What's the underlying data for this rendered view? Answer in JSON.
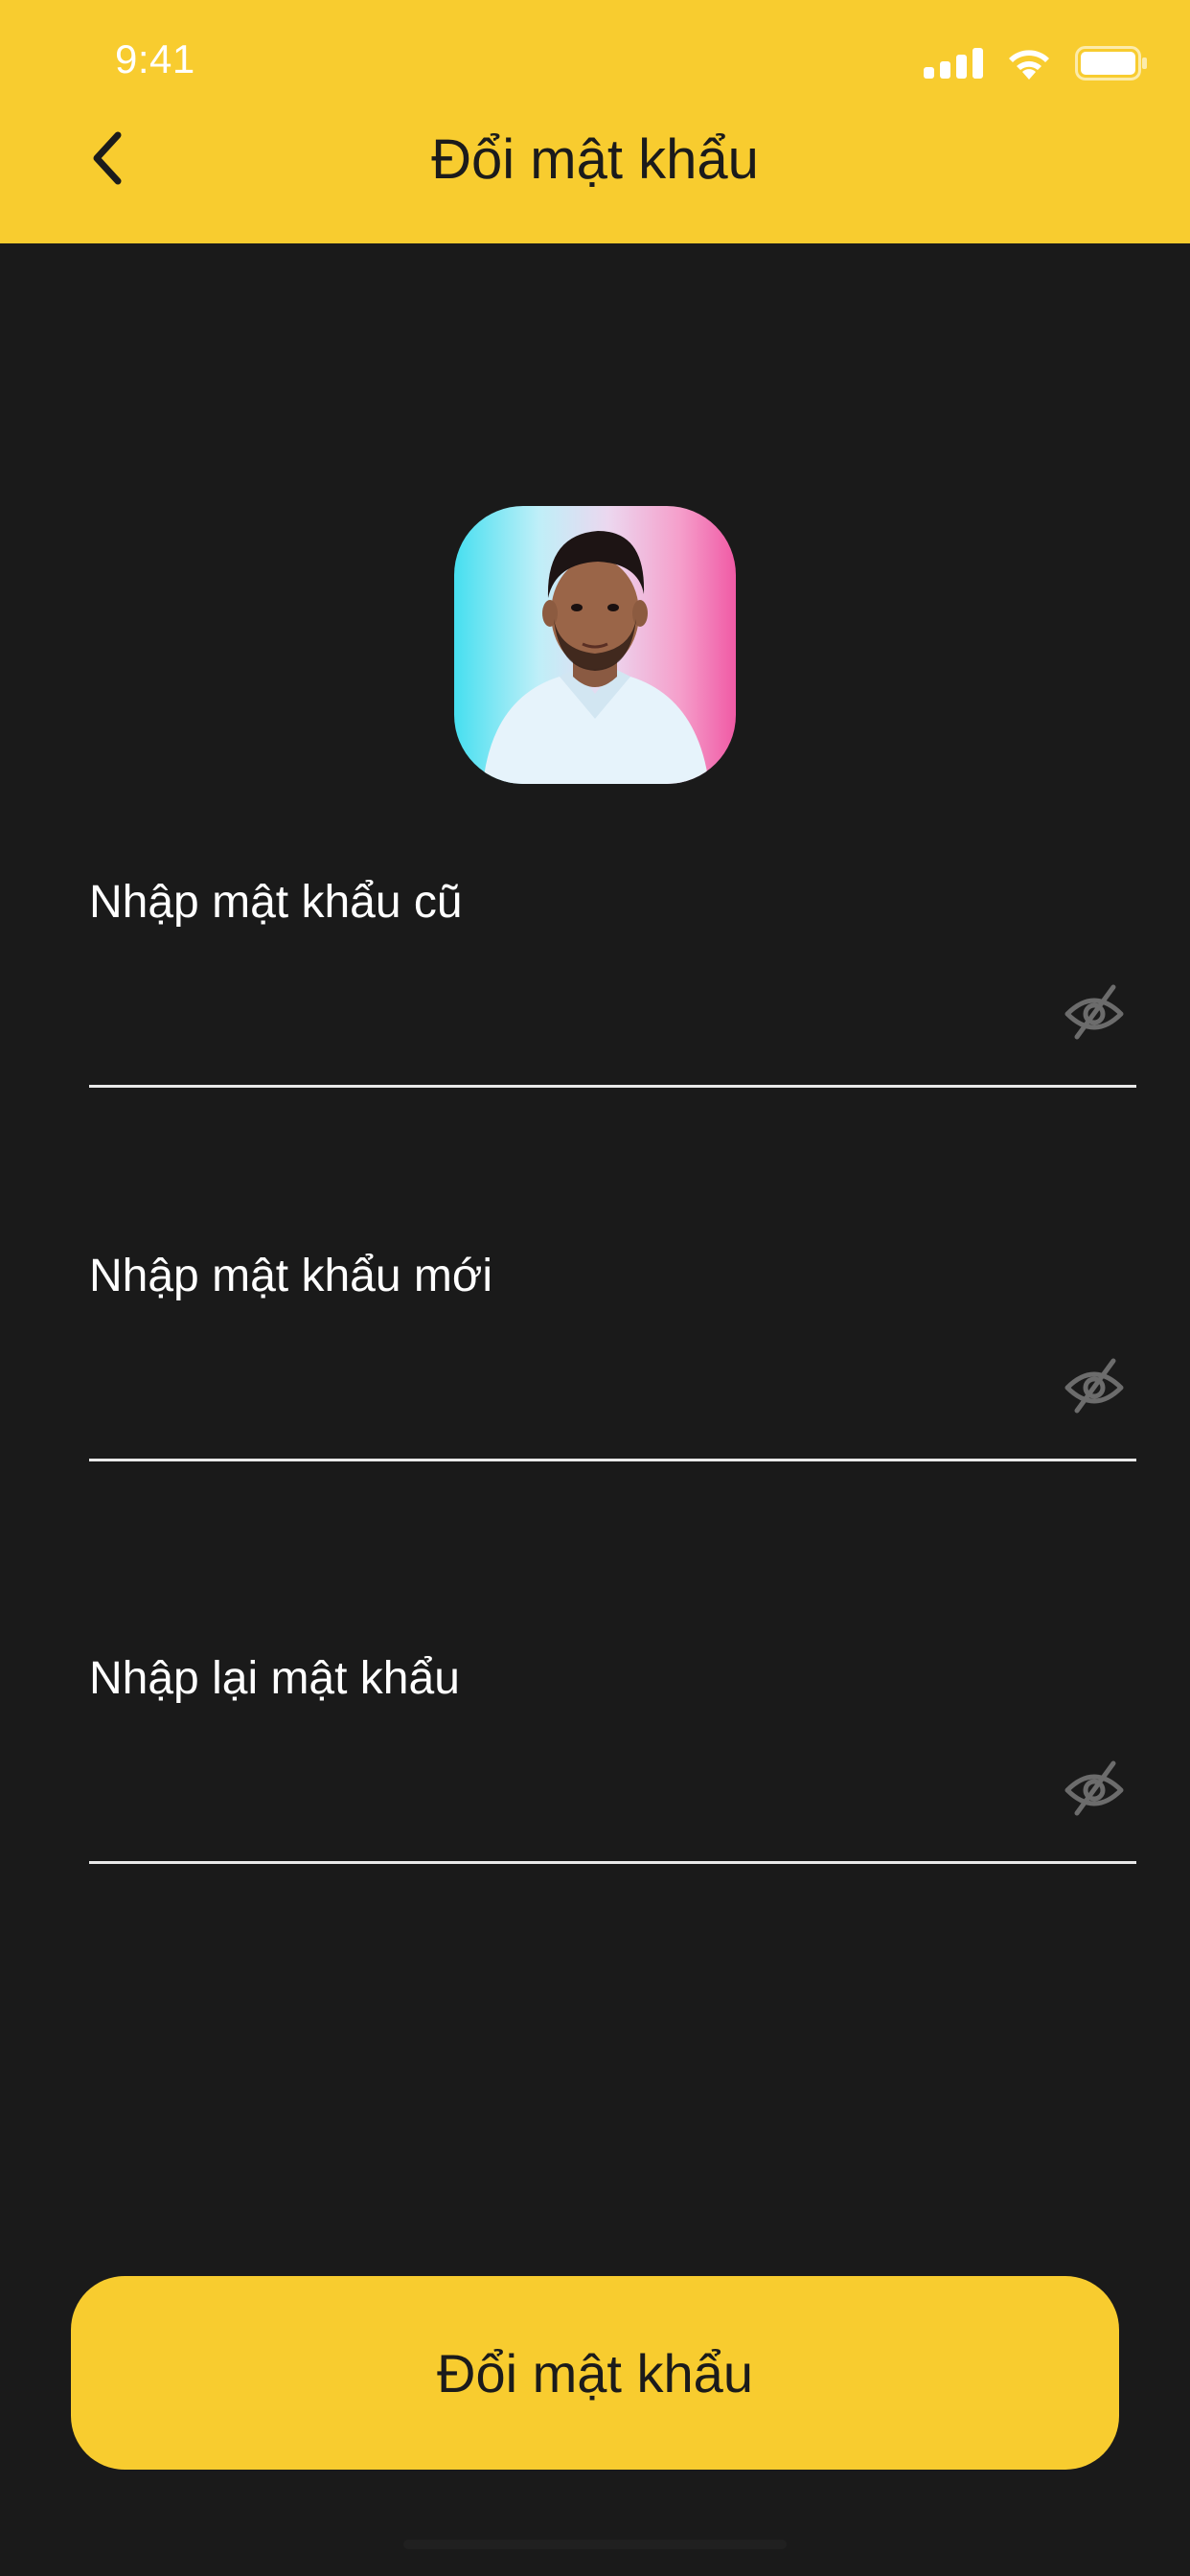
{
  "status_bar": {
    "time": "9:41",
    "icons": [
      "cellular-signal-icon",
      "wifi-icon",
      "battery-icon"
    ]
  },
  "header": {
    "title": "Đổi mật khẩu",
    "back_icon": "chevron-left-icon",
    "background_color": "#f8cc2f"
  },
  "profile": {
    "avatar": "user-avatar-photo"
  },
  "form": {
    "old_password": {
      "label": "Nhập mật khẩu cũ",
      "value": "",
      "visibility_icon": "eye-slash-icon"
    },
    "new_password": {
      "label": "Nhập mật khẩu mới",
      "value": "",
      "visibility_icon": "eye-slash-icon"
    },
    "confirm_password": {
      "label": "Nhập lại mật khẩu",
      "value": "",
      "visibility_icon": "eye-slash-icon"
    }
  },
  "submit": {
    "label": "Đổi mật khẩu",
    "background_color": "#f8cc2f"
  },
  "colors": {
    "background": "#1a1a1a",
    "accent": "#f8cc2f",
    "text": "#ffffff"
  }
}
